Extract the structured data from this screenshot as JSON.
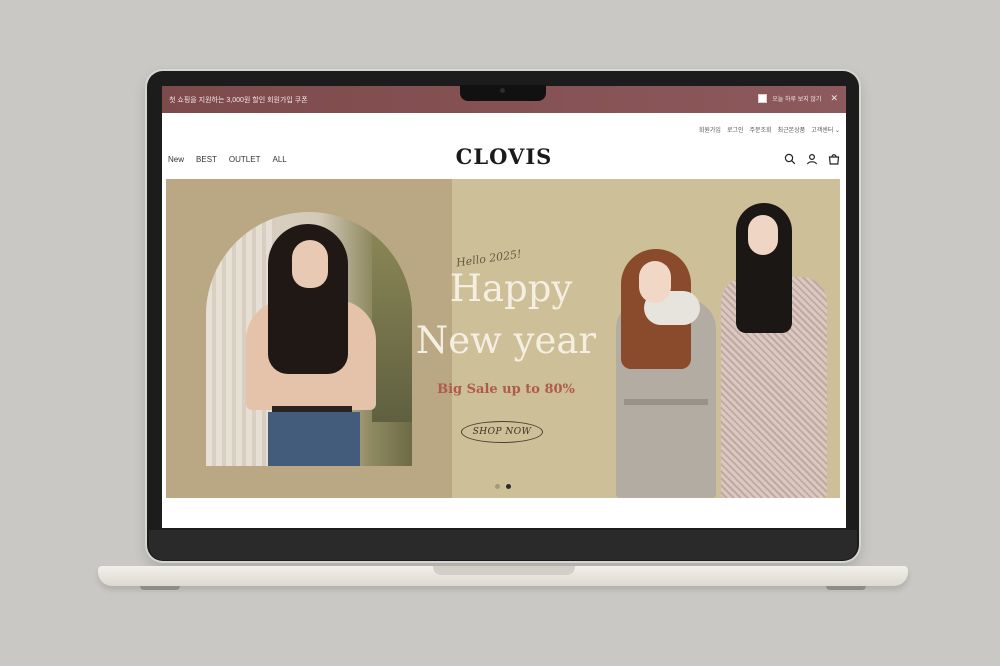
{
  "promo_bar": {
    "text": "첫 쇼핑을 지원하는 3,000원 할인 회원가입 쿠폰",
    "hide_today_label": "오늘 하루 보지 않기",
    "close_glyph": "✕"
  },
  "utility_links": [
    "회원가입",
    "로그인",
    "주문조회",
    "최근본상품",
    "고객센터"
  ],
  "header": {
    "logo": "CLOVIS",
    "nav": [
      "New",
      "BEST",
      "OUTLET",
      "ALL"
    ],
    "icons": [
      "search-icon",
      "user-icon",
      "cart-icon"
    ]
  },
  "hero": {
    "hello": "Hello 2025!",
    "headline_line1": "Happy",
    "headline_line2": "New year",
    "sale": "Big Sale up to 80%",
    "cta": "SHOP NOW",
    "slides": 2,
    "active_slide": 2
  },
  "colors": {
    "promo_bg": "#84505 2",
    "hero_bg": "#cdbf98",
    "sale_text": "#b05a4e"
  }
}
